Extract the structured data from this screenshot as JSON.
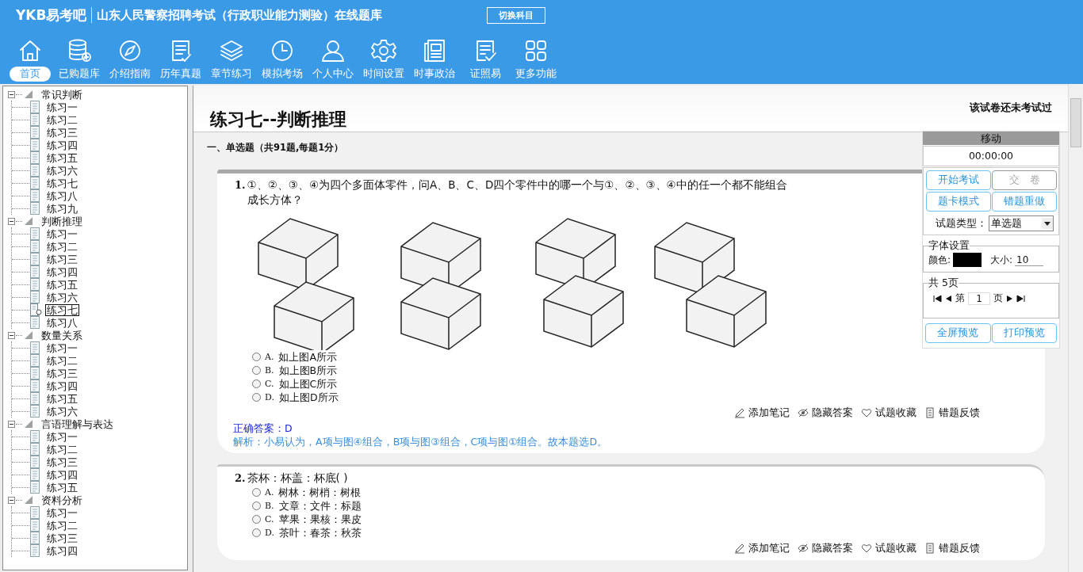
{
  "header": {
    "logo": "YKB易考吧",
    "title": "山东人民警察招聘考试（行政职业能力测验）在线题库",
    "switch_button": "切换科目"
  },
  "toolbar": [
    {
      "kind": "home",
      "label": "首页",
      "selected": true
    },
    {
      "kind": "database",
      "label": "已购题库",
      "selected": false
    },
    {
      "kind": "compass",
      "label": "介绍指南",
      "selected": false
    },
    {
      "kind": "list",
      "label": "历年真题",
      "selected": false
    },
    {
      "kind": "layers",
      "label": "章节练习",
      "selected": false
    },
    {
      "kind": "clock",
      "label": "模拟考场",
      "selected": false
    },
    {
      "kind": "person",
      "label": "个人中心",
      "selected": false
    },
    {
      "kind": "gear",
      "label": "时间设置",
      "selected": false
    },
    {
      "kind": "news",
      "label": "时事政治",
      "selected": false
    },
    {
      "kind": "check",
      "label": "证照易",
      "selected": false
    },
    {
      "kind": "grid",
      "label": "更多功能",
      "selected": false
    }
  ],
  "tree": [
    {
      "label": "常识判断",
      "expanded": true,
      "children": [
        {
          "label": "练习一",
          "selected": false
        },
        {
          "label": "练习二",
          "selected": false
        },
        {
          "label": "练习三",
          "selected": false
        },
        {
          "label": "练习四",
          "selected": false
        },
        {
          "label": "练习五",
          "selected": false
        },
        {
          "label": "练习六",
          "selected": false
        },
        {
          "label": "练习七",
          "selected": false
        },
        {
          "label": "练习八",
          "selected": false
        },
        {
          "label": "练习九",
          "selected": false
        }
      ]
    },
    {
      "label": "判断推理",
      "expanded": true,
      "children": [
        {
          "label": "练习一",
          "selected": false
        },
        {
          "label": "练习二",
          "selected": false
        },
        {
          "label": "练习三",
          "selected": false
        },
        {
          "label": "练习四",
          "selected": false
        },
        {
          "label": "练习五",
          "selected": false
        },
        {
          "label": "练习六",
          "selected": false
        },
        {
          "label": "练习七",
          "selected": true
        },
        {
          "label": "练习八",
          "selected": false
        }
      ]
    },
    {
      "label": "数量关系",
      "expanded": true,
      "children": [
        {
          "label": "练习一",
          "selected": false
        },
        {
          "label": "练习二",
          "selected": false
        },
        {
          "label": "练习三",
          "selected": false
        },
        {
          "label": "练习四",
          "selected": false
        },
        {
          "label": "练习五",
          "selected": false
        },
        {
          "label": "练习六",
          "selected": false
        }
      ]
    },
    {
      "label": "言语理解与表达",
      "expanded": true,
      "children": [
        {
          "label": "练习一",
          "selected": false
        },
        {
          "label": "练习二",
          "selected": false
        },
        {
          "label": "练习三",
          "selected": false
        },
        {
          "label": "练习四",
          "selected": false
        },
        {
          "label": "练习五",
          "selected": false
        }
      ]
    },
    {
      "label": "资料分析",
      "expanded": true,
      "children": [
        {
          "label": "练习一",
          "selected": false
        },
        {
          "label": "练习二",
          "selected": false
        },
        {
          "label": "练习三",
          "selected": false
        },
        {
          "label": "练习四",
          "selected": false
        }
      ]
    }
  ],
  "exam": {
    "title": "练习七--判断推理",
    "status": "该试卷还未考试过",
    "section": "一、单选题（共91题,每题1分）"
  },
  "questions": [
    {
      "number": "1.",
      "text": "①、②、③、④为四个多面体零件，问A、B、C、D四个零件中的哪一个与①、②、③、④中的任一个都不能组合成长方体？",
      "figure": {
        "kind": "picture"
      },
      "options": [
        {
          "label": "A.",
          "text": "如上图A所示",
          "selected": false
        },
        {
          "label": "B.",
          "text": "如上图B所示",
          "selected": false
        },
        {
          "label": "C.",
          "text": "如上图C所示",
          "selected": false
        },
        {
          "label": "D.",
          "text": "如上图D所示",
          "selected": false
        }
      ],
      "actions": [
        {
          "kind": "note",
          "label": "添加笔记"
        },
        {
          "kind": "hide",
          "label": "隐藏答案"
        },
        {
          "kind": "favorite",
          "label": "试题收藏"
        },
        {
          "kind": "feedback",
          "label": "错题反馈"
        }
      ],
      "answer": "正确答案：D",
      "analysis": "解析：小易认为，A项与图④组合，B项与图③组合，C项与图①组合。故本题选D。"
    },
    {
      "number": "2.",
      "text": "茶杯：杯盖：杯底( )",
      "options": [
        {
          "label": "A.",
          "text": "树林：树梢：树根",
          "selected": false
        },
        {
          "label": "B.",
          "text": "文章：文件：标题",
          "selected": false
        },
        {
          "label": "C.",
          "text": "苹果：果核：果皮",
          "selected": false
        },
        {
          "label": "D.",
          "text": "茶叶：春茶：秋茶",
          "selected": false
        }
      ],
      "actions": [
        {
          "kind": "note",
          "label": "添加笔记"
        },
        {
          "kind": "hide",
          "label": "隐藏答案"
        },
        {
          "kind": "favorite",
          "label": "试题收藏"
        },
        {
          "kind": "feedback",
          "label": "错题反馈"
        }
      ]
    }
  ],
  "panel": {
    "header": "移动",
    "timer": "00:00:00",
    "buttons": [
      {
        "label": "开始考试",
        "disabled": false
      },
      {
        "label": "交　卷",
        "disabled": true
      },
      {
        "label": "题卡模式",
        "disabled": false
      },
      {
        "label": "错题重做",
        "disabled": false
      }
    ],
    "type_label": "试题类型：",
    "type_value": "单选题",
    "font_legend": "字体设置",
    "color_label": "颜色:",
    "swatch": {
      "color": "#000000"
    },
    "size_label": "大小:",
    "size_value": "10",
    "pager_legend": "共 5页",
    "page_prefix": "第",
    "page_value": "1",
    "page_suffix": "页",
    "bottom_buttons": [
      {
        "label": "全屏预览",
        "disabled": false
      },
      {
        "label": "打印预览",
        "disabled": false
      }
    ]
  }
}
